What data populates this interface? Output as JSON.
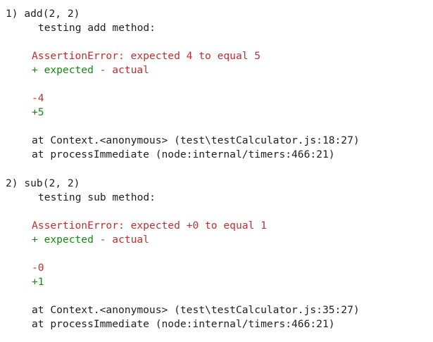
{
  "colors": {
    "text": "#1f1f1f",
    "error_red": "#c22f2f",
    "success_green": "#128a12",
    "background": "#ffffff"
  },
  "failures": [
    {
      "header": "1) add(2, 2)",
      "description": "testing add method:",
      "error": "AssertionError: expected 4 to equal 5",
      "diff_legend": {
        "expected": "+ expected",
        "actual": "- actual"
      },
      "diff_minus": "-4",
      "diff_plus": "+5",
      "stack": [
        "at Context.<anonymous> (test\\testCalculator.js:18:27)",
        "at processImmediate (node:internal/timers:466:21)"
      ]
    },
    {
      "header": "2) sub(2, 2)",
      "description": "testing sub method:",
      "error": "AssertionError: expected +0 to equal 1",
      "diff_legend": {
        "expected": "+ expected",
        "actual": "- actual"
      },
      "diff_minus": "-0",
      "diff_plus": "+1",
      "stack": [
        "at Context.<anonymous> (test\\testCalculator.js:35:27)",
        "at processImmediate (node:internal/timers:466:21)"
      ]
    }
  ]
}
